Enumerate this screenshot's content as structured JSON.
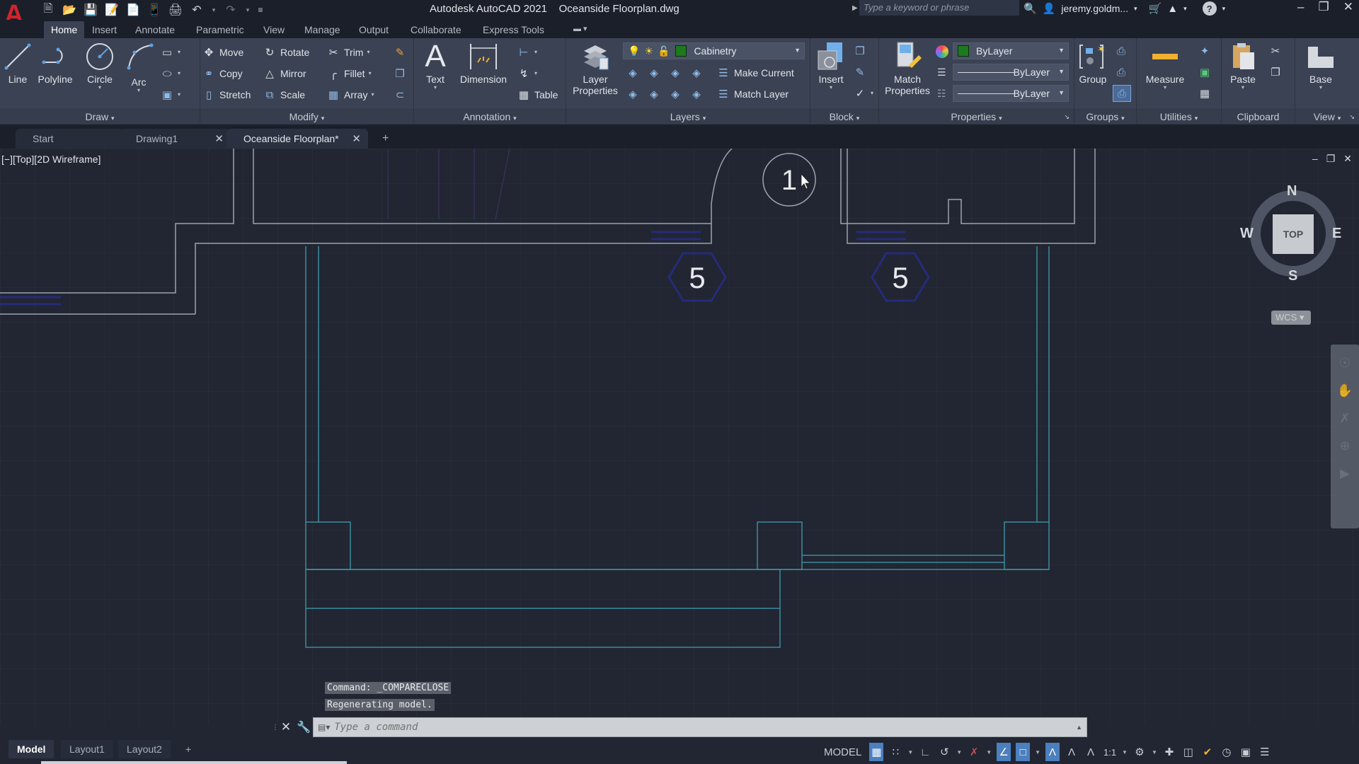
{
  "app": {
    "logo": "A",
    "title": "Autodesk AutoCAD 2021    Oceanside Floorplan.dwg",
    "search_placeholder": "Type a keyword or phrase",
    "user": "jeremy.goldm...",
    "quick_access": [
      "new-icon",
      "open-icon",
      "save-icon",
      "save-as-icon",
      "publish-icon",
      "share-icon",
      "plot-icon",
      "undo-icon",
      "redo-icon",
      "customize-icon"
    ]
  },
  "ribbon_tabs": [
    "Home",
    "Insert",
    "Annotate",
    "Parametric",
    "View",
    "Manage",
    "Output",
    "Collaborate",
    "Express Tools"
  ],
  "active_ribbon_tab": "Home",
  "panels": {
    "draw": {
      "title": "Draw",
      "line": "Line",
      "polyline": "Polyline",
      "circle": "Circle",
      "arc": "Arc"
    },
    "modify": {
      "title": "Modify",
      "move": "Move",
      "rotate": "Rotate",
      "trim": "Trim",
      "copy": "Copy",
      "mirror": "Mirror",
      "fillet": "Fillet",
      "stretch": "Stretch",
      "scale": "Scale",
      "array": "Array"
    },
    "annotation": {
      "title": "Annotation",
      "text": "Text",
      "dimension": "Dimension",
      "table": "Table"
    },
    "layers": {
      "title": "Layers",
      "layer_properties_1": "Layer",
      "layer_properties_2": "Properties",
      "current_layer": "Cabinetry",
      "current_layer_color": "#1e7a1e",
      "make_current": "Make Current",
      "match_layer": "Match Layer"
    },
    "block": {
      "title": "Block",
      "insert": "Insert"
    },
    "properties": {
      "title": "Properties",
      "match_1": "Match",
      "match_2": "Properties",
      "color": "ByLayer",
      "color_swatch": "#1e7a1e",
      "lineweight": "ByLayer",
      "linetype": "ByLayer"
    },
    "groups": {
      "title": "Groups",
      "group": "Group"
    },
    "utilities": {
      "title": "Utilities",
      "measure": "Measure"
    },
    "clipboard": {
      "title": "Clipboard",
      "paste": "Paste"
    },
    "view": {
      "title": "View",
      "base": "Base"
    }
  },
  "doc_tabs": [
    {
      "label": "Start",
      "closable": false
    },
    {
      "label": "Drawing1",
      "closable": true
    },
    {
      "label": "Oceanside Floorplan*",
      "closable": true,
      "active": true
    }
  ],
  "viewport": {
    "label": "[−][Top][2D Wireframe]",
    "viewcube": {
      "face": "TOP",
      "n": "N",
      "s": "S",
      "e": "E",
      "w": "W",
      "ucs": "WCS ▾"
    },
    "tags": {
      "room_number": "1",
      "door_tag_a": "5",
      "door_tag_b": "5"
    }
  },
  "command": {
    "history": [
      "Command: _COMPARECLOSE",
      "Regenerating model."
    ],
    "placeholder": "Type a command"
  },
  "layout_tabs": [
    "Model",
    "Layout1",
    "Layout2"
  ],
  "active_layout": "Model",
  "status": {
    "mode": "MODEL",
    "annotation_scale": "1:1",
    "grid_on": true,
    "ortho_polar_on": true,
    "annotation_visibility_on": true
  }
}
